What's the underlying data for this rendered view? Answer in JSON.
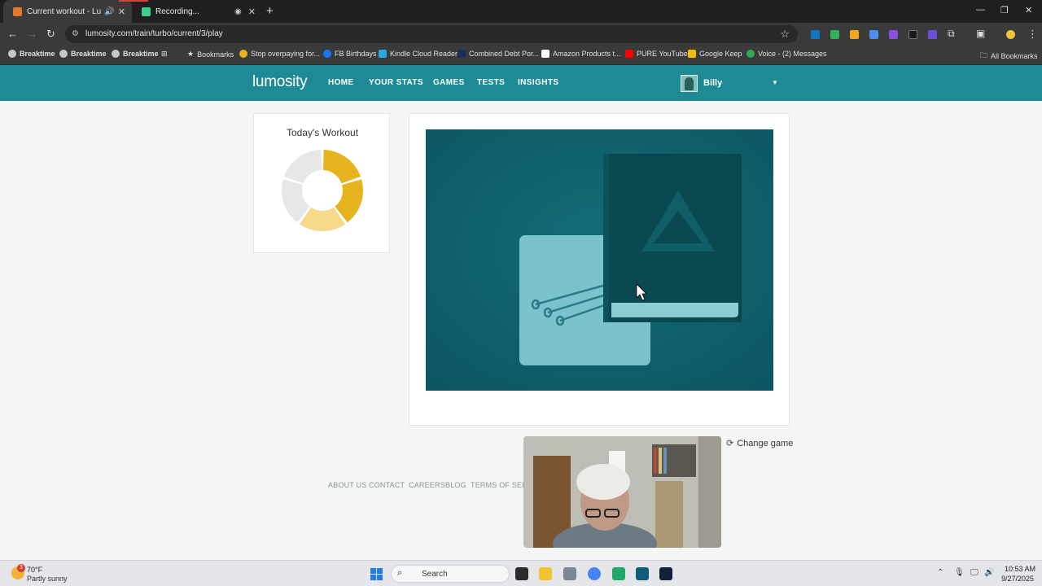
{
  "browser": {
    "tabs": [
      {
        "title": "Current workout - Lumosity",
        "active": true,
        "favicon_color": "#e8772e"
      },
      {
        "title": "Recording...",
        "active": false,
        "favicon_color": "#3ecf8e"
      }
    ],
    "url": "lumosity.com/train/turbo/current/3/play",
    "bookmarks": [
      {
        "label": "Breaktime",
        "bold": true
      },
      {
        "label": "Breaktime",
        "bold": true
      },
      {
        "label": "Breaktime",
        "bold": true
      },
      {
        "label": "Bookmarks",
        "bold": false
      },
      {
        "label": "Stop overpaying for...",
        "bold": false
      },
      {
        "label": "FB Birthdays",
        "bold": false
      },
      {
        "label": "Kindle Cloud Reader",
        "bold": false
      },
      {
        "label": "Combined Debt Por...",
        "bold": false
      },
      {
        "label": "Amazon Products t...",
        "bold": false
      },
      {
        "label": "PURE YouTube",
        "bold": false
      },
      {
        "label": "Google Keep",
        "bold": false
      },
      {
        "label": "Voice - (2) Messages",
        "bold": false
      }
    ],
    "all_bookmarks": "All Bookmarks"
  },
  "site": {
    "logo": "lumosity",
    "nav": [
      "HOME",
      "YOUR STATS",
      "GAMES",
      "TESTS",
      "INSIGHTS"
    ],
    "user": "Billy",
    "brand_color": "#1e8a96"
  },
  "workout": {
    "title": "Today's Workout",
    "games_completed": 2,
    "games_total": 5
  },
  "game": {
    "change_game_label": "Change game"
  },
  "footer": {
    "links": [
      "ABOUT US",
      "CONTACT",
      "CAREERS",
      "BLOG",
      "TERMS OF SERVI"
    ]
  },
  "taskbar": {
    "weather_temp": "70°F",
    "weather_condition": "Partly sunny",
    "weather_badge": "3",
    "search_label": "Search",
    "time": "10:53 AM",
    "date": "9/27/2025"
  }
}
